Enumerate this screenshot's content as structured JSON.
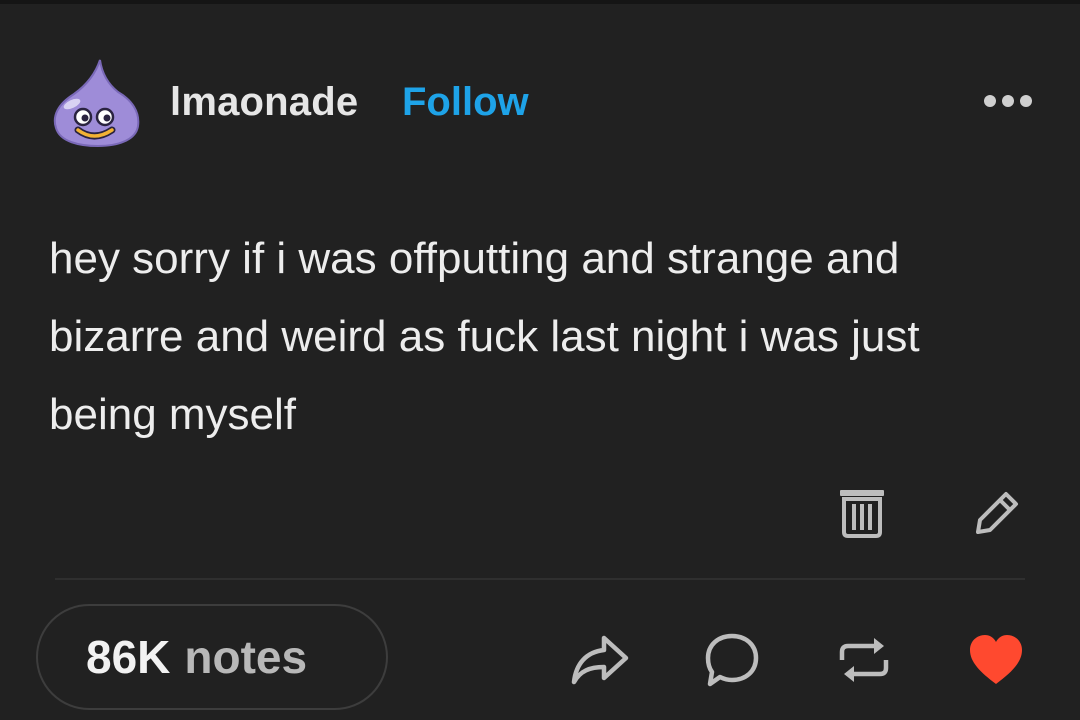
{
  "post": {
    "author": "lmaonade",
    "follow_label": "Follow",
    "more_icon": "ellipsis-icon",
    "text": "hey sorry if i was offputting and strange and bizarre and weird as fuck last night i was just being myself",
    "tools": [
      "trash-icon",
      "pencil-icon"
    ]
  },
  "footer": {
    "notes_count": "86K",
    "notes_label": "notes",
    "actions": [
      "share-icon",
      "reply-icon",
      "reblog-icon",
      "heart-icon"
    ]
  },
  "colors": {
    "background": "#212121",
    "follow": "#1ea3e8",
    "heart": "#ff492f",
    "avatar": "#9e8cd8"
  }
}
